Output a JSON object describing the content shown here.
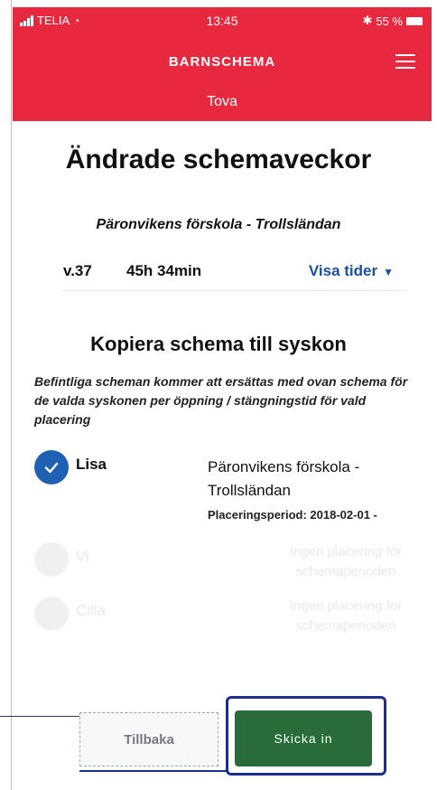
{
  "status_bar": {
    "carrier": "TELIA",
    "time": "13:45",
    "battery_text": "55 %"
  },
  "app_bar": {
    "title": "BARNSCHEMA",
    "child_name": "Tova",
    "menu_icon": "hamburger-menu-icon"
  },
  "page": {
    "heading": "Ändrade schemaveckor",
    "school": "Päronvikens förskola - Trollsländan"
  },
  "week_row": {
    "week": "v.37",
    "hours": "45h 34min",
    "show_times_label": "Visa tider",
    "show_times_icon": "caret-down-icon"
  },
  "copy_section": {
    "heading": "Kopiera schema till syskon",
    "info": "Befintliga scheman kommer att ersättas med ovan schema för de valda syskonen per öppning / stängningstid för vald placering",
    "siblings": [
      {
        "name": "Lisa",
        "checked": true,
        "placement": "Päronvikens förskola - Trollsländan",
        "period": "Placeringsperiod: 2018-02-01 -"
      },
      {
        "name": "Vi",
        "checked": false,
        "placement": "Ingen placering för schemaperioden"
      },
      {
        "name": "Cilla",
        "checked": false,
        "placement": "Ingen placering för schemaperioden"
      }
    ]
  },
  "buttons": {
    "back_label": "Tillbaka",
    "submit_label": "Skicka in"
  },
  "colors": {
    "brand_red": "#e8283f",
    "link_blue": "#1b4f9c",
    "check_blue": "#1f5fb4",
    "submit_green": "#2a6b3a"
  }
}
